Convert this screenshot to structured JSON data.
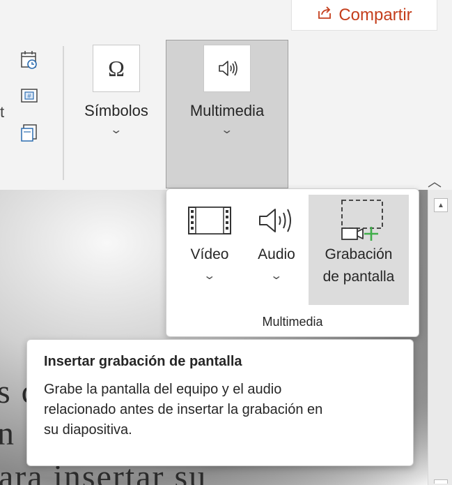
{
  "ribbon": {
    "share_label": "Compartir",
    "truncated_text": "t",
    "collapse_icon": "chevron-up-icon"
  },
  "symbols": {
    "label": "Símbolos",
    "icon": "omega-icon"
  },
  "multimedia": {
    "label": "Multimedia",
    "icon": "speaker-icon"
  },
  "dropdown": {
    "items": [
      {
        "label": "Vídeo",
        "icon": "video-icon"
      },
      {
        "label": "Audio",
        "icon": "audio-icon"
      },
      {
        "label_line1": "Grabación",
        "label_line2": "de pantalla",
        "icon": "screen-recording-icon"
      }
    ],
    "group_label": "Multimedia"
  },
  "tooltip": {
    "title": "Insertar grabación de pantalla",
    "body_line1": "Grabe la pantalla del equipo y el audio",
    "body_line2": "relacionado antes de insertar la grabación en",
    "body_line3": "su diapositiva."
  },
  "slide": {
    "text_line1_fragment": "s c",
    "text_line2_fragment": "n",
    "text_line3_fragment": "ara insertar su"
  },
  "colors": {
    "accent": "#c43e1c",
    "pressed_bg": "#d2d2d2",
    "hover_bg": "#dcdcdc",
    "green_plus": "#3fae49",
    "blue_icon": "#2b6cb0"
  }
}
